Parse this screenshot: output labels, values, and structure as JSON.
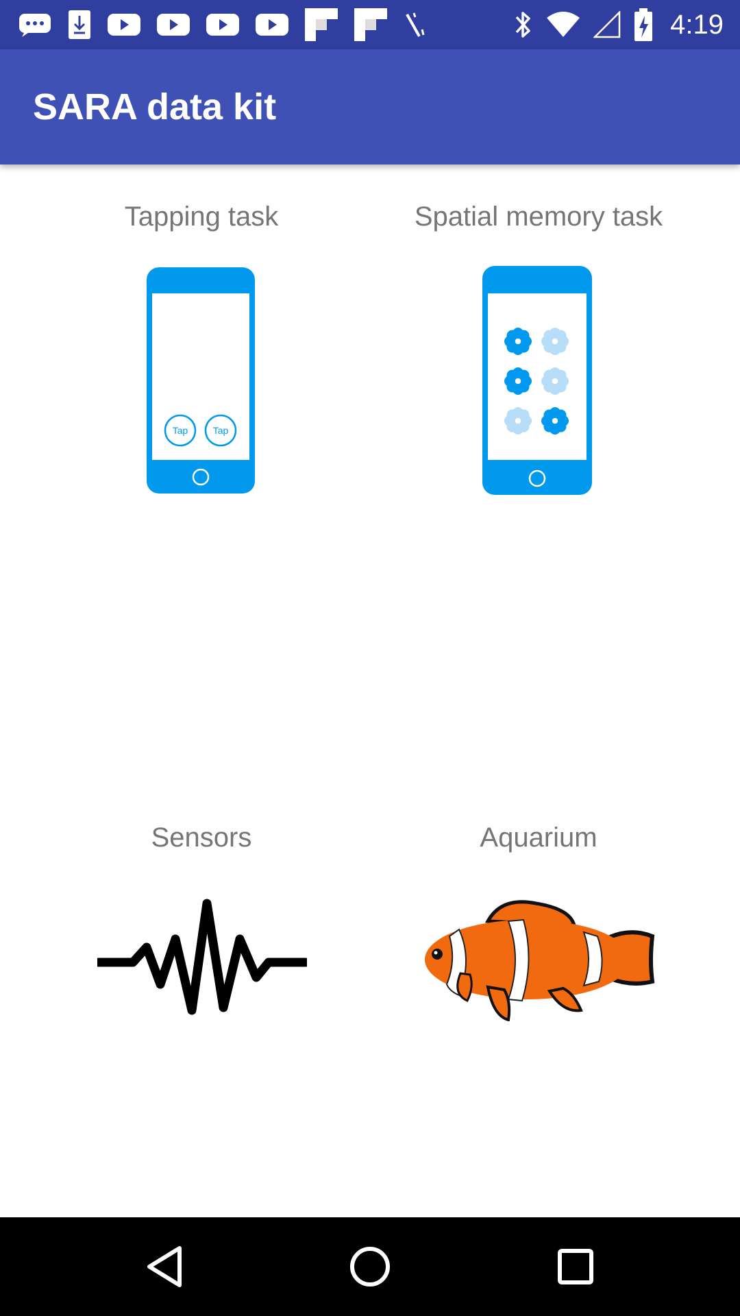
{
  "status_bar": {
    "time": "4:19",
    "notification_icons": [
      "chat-icon",
      "download-icon",
      "youtube-icon",
      "youtube-icon",
      "youtube-icon",
      "youtube-icon",
      "flipboard-icon",
      "flipboard-icon",
      "tool-icon"
    ],
    "system_icons": [
      "bluetooth-icon",
      "wifi-icon",
      "cell-signal-icon",
      "battery-charging-icon"
    ]
  },
  "app_bar": {
    "title": "SARA data kit"
  },
  "tiles": [
    {
      "label": "Tapping task",
      "icon": "phone-tap-icon",
      "buttons": [
        "Tap",
        "Tap"
      ]
    },
    {
      "label": "Spatial memory task",
      "icon": "phone-flowers-icon"
    },
    {
      "label": "Sensors",
      "icon": "waveform-icon"
    },
    {
      "label": "Aquarium",
      "icon": "clownfish-icon"
    }
  ],
  "colors": {
    "status_bar": "#303F9F",
    "app_bar": "#3F51B5",
    "label": "#757575",
    "phone_blue": "#0099EE",
    "flower_light": "#B8DDF8",
    "fish_orange": "#F26A10"
  },
  "nav_bar": {
    "buttons": [
      "back-icon",
      "home-icon",
      "recents-icon"
    ]
  }
}
